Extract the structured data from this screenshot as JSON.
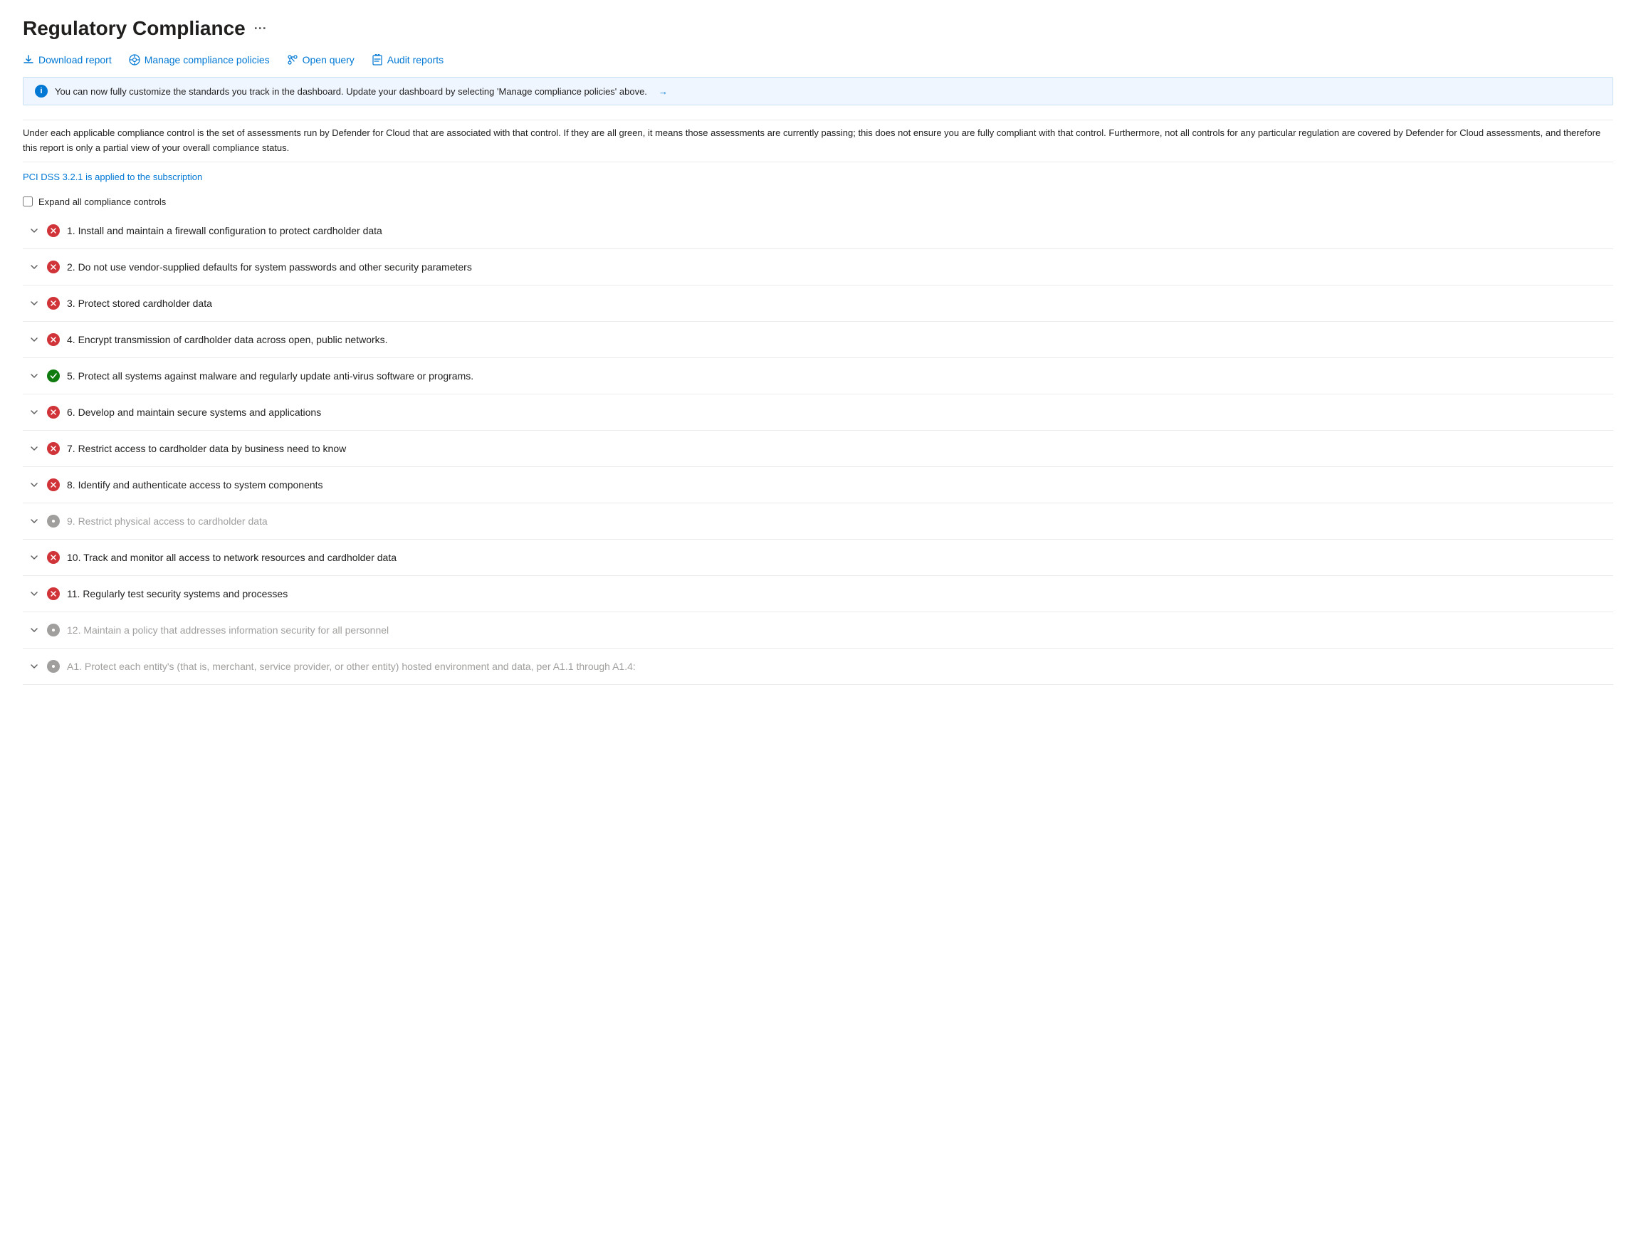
{
  "page": {
    "title": "Regulatory Compliance",
    "ellipsis": "···"
  },
  "toolbar": {
    "buttons": [
      {
        "id": "download-report",
        "label": "Download report",
        "icon": "download"
      },
      {
        "id": "manage-policies",
        "label": "Manage compliance policies",
        "icon": "settings-circle"
      },
      {
        "id": "open-query",
        "label": "Open query",
        "icon": "branch"
      },
      {
        "id": "audit-reports",
        "label": "Audit reports",
        "icon": "clipboard"
      }
    ]
  },
  "info_banner": {
    "text": "You can now fully customize the standards you track in the dashboard. Update your dashboard by selecting 'Manage compliance policies' above.",
    "arrow": "→"
  },
  "description": "Under each applicable compliance control is the set of assessments run by Defender for Cloud that are associated with that control. If they are all green, it means those assessments are currently passing; this does not ensure you are fully compliant with that control. Furthermore, not all controls for any particular regulation are covered by Defender for Cloud assessments, and therefore this report is only a partial view of your overall compliance status.",
  "pci_link": "PCI DSS 3.2.1 is applied to the subscription",
  "expand_all_label": "Expand all compliance controls",
  "controls": [
    {
      "id": 1,
      "status": "red",
      "label": "1. Install and maintain a firewall configuration to protect cardholder data",
      "gray": false
    },
    {
      "id": 2,
      "status": "red",
      "label": "2. Do not use vendor-supplied defaults for system passwords and other security parameters",
      "gray": false
    },
    {
      "id": 3,
      "status": "red",
      "label": "3. Protect stored cardholder data",
      "gray": false
    },
    {
      "id": 4,
      "status": "red",
      "label": "4. Encrypt transmission of cardholder data across open, public networks.",
      "gray": false
    },
    {
      "id": 5,
      "status": "green",
      "label": "5. Protect all systems against malware and regularly update anti-virus software or programs.",
      "gray": false
    },
    {
      "id": 6,
      "status": "red",
      "label": "6. Develop and maintain secure systems and applications",
      "gray": false
    },
    {
      "id": 7,
      "status": "red",
      "label": "7. Restrict access to cardholder data by business need to know",
      "gray": false
    },
    {
      "id": 8,
      "status": "red",
      "label": "8. Identify and authenticate access to system components",
      "gray": false
    },
    {
      "id": 9,
      "status": "gray",
      "label": "9. Restrict physical access to cardholder data",
      "gray": true
    },
    {
      "id": 10,
      "status": "red",
      "label": "10. Track and monitor all access to network resources and cardholder data",
      "gray": false
    },
    {
      "id": 11,
      "status": "red",
      "label": "11. Regularly test security systems and processes",
      "gray": false
    },
    {
      "id": 12,
      "status": "gray",
      "label": "12. Maintain a policy that addresses information security for all personnel",
      "gray": true
    },
    {
      "id": 13,
      "status": "gray",
      "label": "A1. Protect each entity's (that is, merchant, service provider, or other entity) hosted environment and data, per A1.1 through A1.4:",
      "gray": true
    }
  ]
}
